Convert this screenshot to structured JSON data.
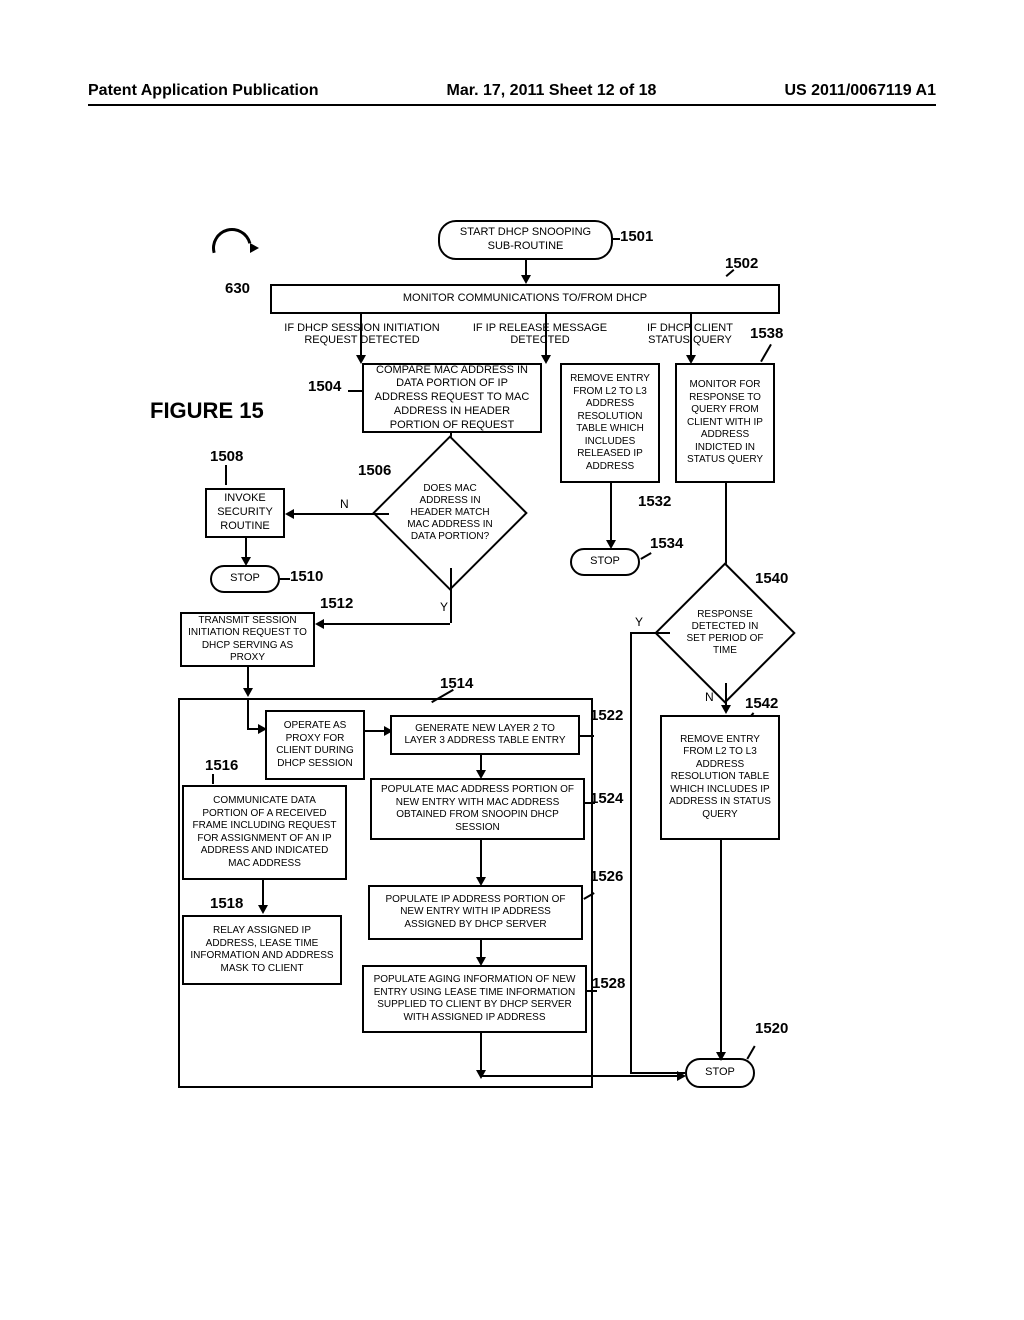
{
  "header": {
    "left": "Patent Application Publication",
    "center": "Mar. 17, 2011  Sheet 12 of 18",
    "right": "US 2011/0067119 A1"
  },
  "figure_title": "FIGURE 15",
  "labels": {
    "n630": "630",
    "n1501": "1501",
    "n1502": "1502",
    "n1504": "1504",
    "n1506": "1506",
    "n1508": "1508",
    "n1510": "1510",
    "n1512": "1512",
    "n1514": "1514",
    "n1516": "1516",
    "n1518": "1518",
    "n1520": "1520",
    "n1522": "1522",
    "n1524": "1524",
    "n1526": "1526",
    "n1528": "1528",
    "n1532": "1532",
    "n1534": "1534",
    "n1538": "1538",
    "n1540": "1540",
    "n1542": "1542"
  },
  "blocks": {
    "start": "START DHCP SNOOPING SUB-ROUTINE",
    "monitor": "MONITOR COMMUNICATIONS TO/FROM DHCP",
    "branch1": "IF DHCP SESSION INITIATION REQUEST DETECTED",
    "branch2": "IF IP RELEASE MESSAGE DETECTED",
    "branch3": "IF DHCP CLIENT STATUS QUERY",
    "compare": "COMPARE MAC ADDRESS IN DATA PORTION OF IP ADDRESS REQUEST TO MAC ADDRESS IN HEADER PORTION OF REQUEST",
    "decision1": "DOES MAC ADDRESS IN HEADER MATCH MAC ADDRESS IN DATA PORTION?",
    "invoke": "INVOKE SECURITY ROUTINE",
    "stop1": "STOP",
    "transmit": "TRANSMIT SESSION INITIATION REQUEST TO DHCP SERVING AS PROXY",
    "proxy": "OPERATE AS PROXY FOR CLIENT DURING DHCP SESSION",
    "generate": "GENERATE NEW LAYER 2 TO LAYER 3 ADDRESS TABLE ENTRY",
    "popmac": "POPULATE MAC ADDRESS PORTION OF NEW ENTRY WITH MAC ADDRESS OBTAINED FROM SNOOPIN DHCP SESSION",
    "popip": "POPULATE IP ADDRESS PORTION OF NEW ENTRY WITH IP ADDRESS ASSIGNED BY DHCP SERVER",
    "popage": "POPULATE AGING INFORMATION OF NEW ENTRY USING LEASE TIME INFORMATION SUPPLIED TO CLIENT BY DHCP SERVER WITH ASSIGNED IP ADDRESS",
    "comm": "COMMUNICATE DATA PORTION OF A RECEIVED FRAME INCLUDING REQUEST FOR ASSIGNMENT OF AN IP ADDRESS AND INDICATED MAC ADDRESS",
    "relay": "RELAY ASSIGNED IP ADDRESS, LEASE TIME INFORMATION AND ADDRESS MASK TO CLIENT",
    "remove1": "REMOVE ENTRY FROM L2 TO L3 ADDRESS RESOLUTION TABLE WHICH INCLUDES RELEASED IP ADDRESS",
    "stop2": "STOP",
    "monitor2": "MONITOR FOR RESPONSE TO QUERY FROM CLIENT WITH IP ADDRESS INDICTED IN STATUS QUERY",
    "decision2": "RESPONSE DETECTED IN SET PERIOD OF TIME",
    "remove2": "REMOVE ENTRY FROM L2 TO L3 ADDRESS RESOLUTION TABLE WHICH INCLUDES IP ADDRESS IN STATUS QUERY",
    "stop3": "STOP"
  },
  "yn": {
    "Y": "Y",
    "N": "N"
  }
}
